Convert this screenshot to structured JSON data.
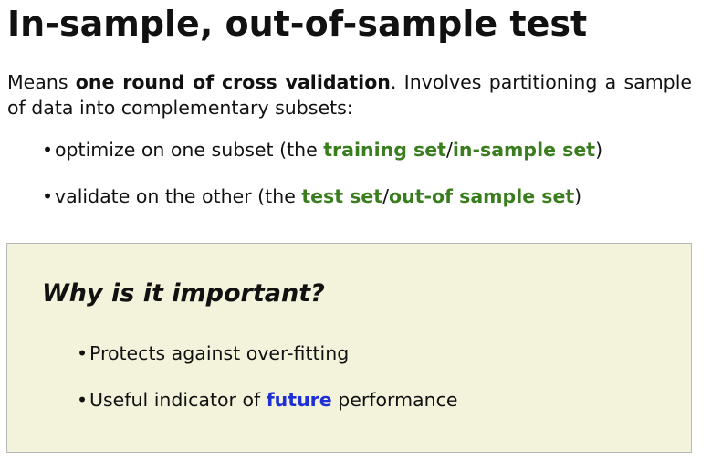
{
  "title": "In-sample, out-of-sample test",
  "intro": {
    "prefix": "Means ",
    "bold": "one round of cross validation",
    "suffix": ". Involves partitioning a sample of data into complementary subsets:"
  },
  "bullet_symbol": "•",
  "bullets": [
    {
      "pre": "optimize on one subset (the ",
      "term1": "training set",
      "sep": "/",
      "term2": "in-sample set",
      "post": ")"
    },
    {
      "pre": "validate on the other (the ",
      "term1": "test set",
      "sep": "/",
      "term2": "out-of sample set",
      "post": ")"
    }
  ],
  "box": {
    "heading": "Why is it important?",
    "items": [
      {
        "text": "Protects against over-fitting"
      },
      {
        "pre": "Useful indicator of ",
        "highlight": "future",
        "post": " performance"
      }
    ]
  },
  "colors": {
    "term_green": "#3a7d1e",
    "highlight_blue": "#1f2fd6",
    "box_background": "#f3f3dc",
    "box_border": "#b8b8b8"
  }
}
